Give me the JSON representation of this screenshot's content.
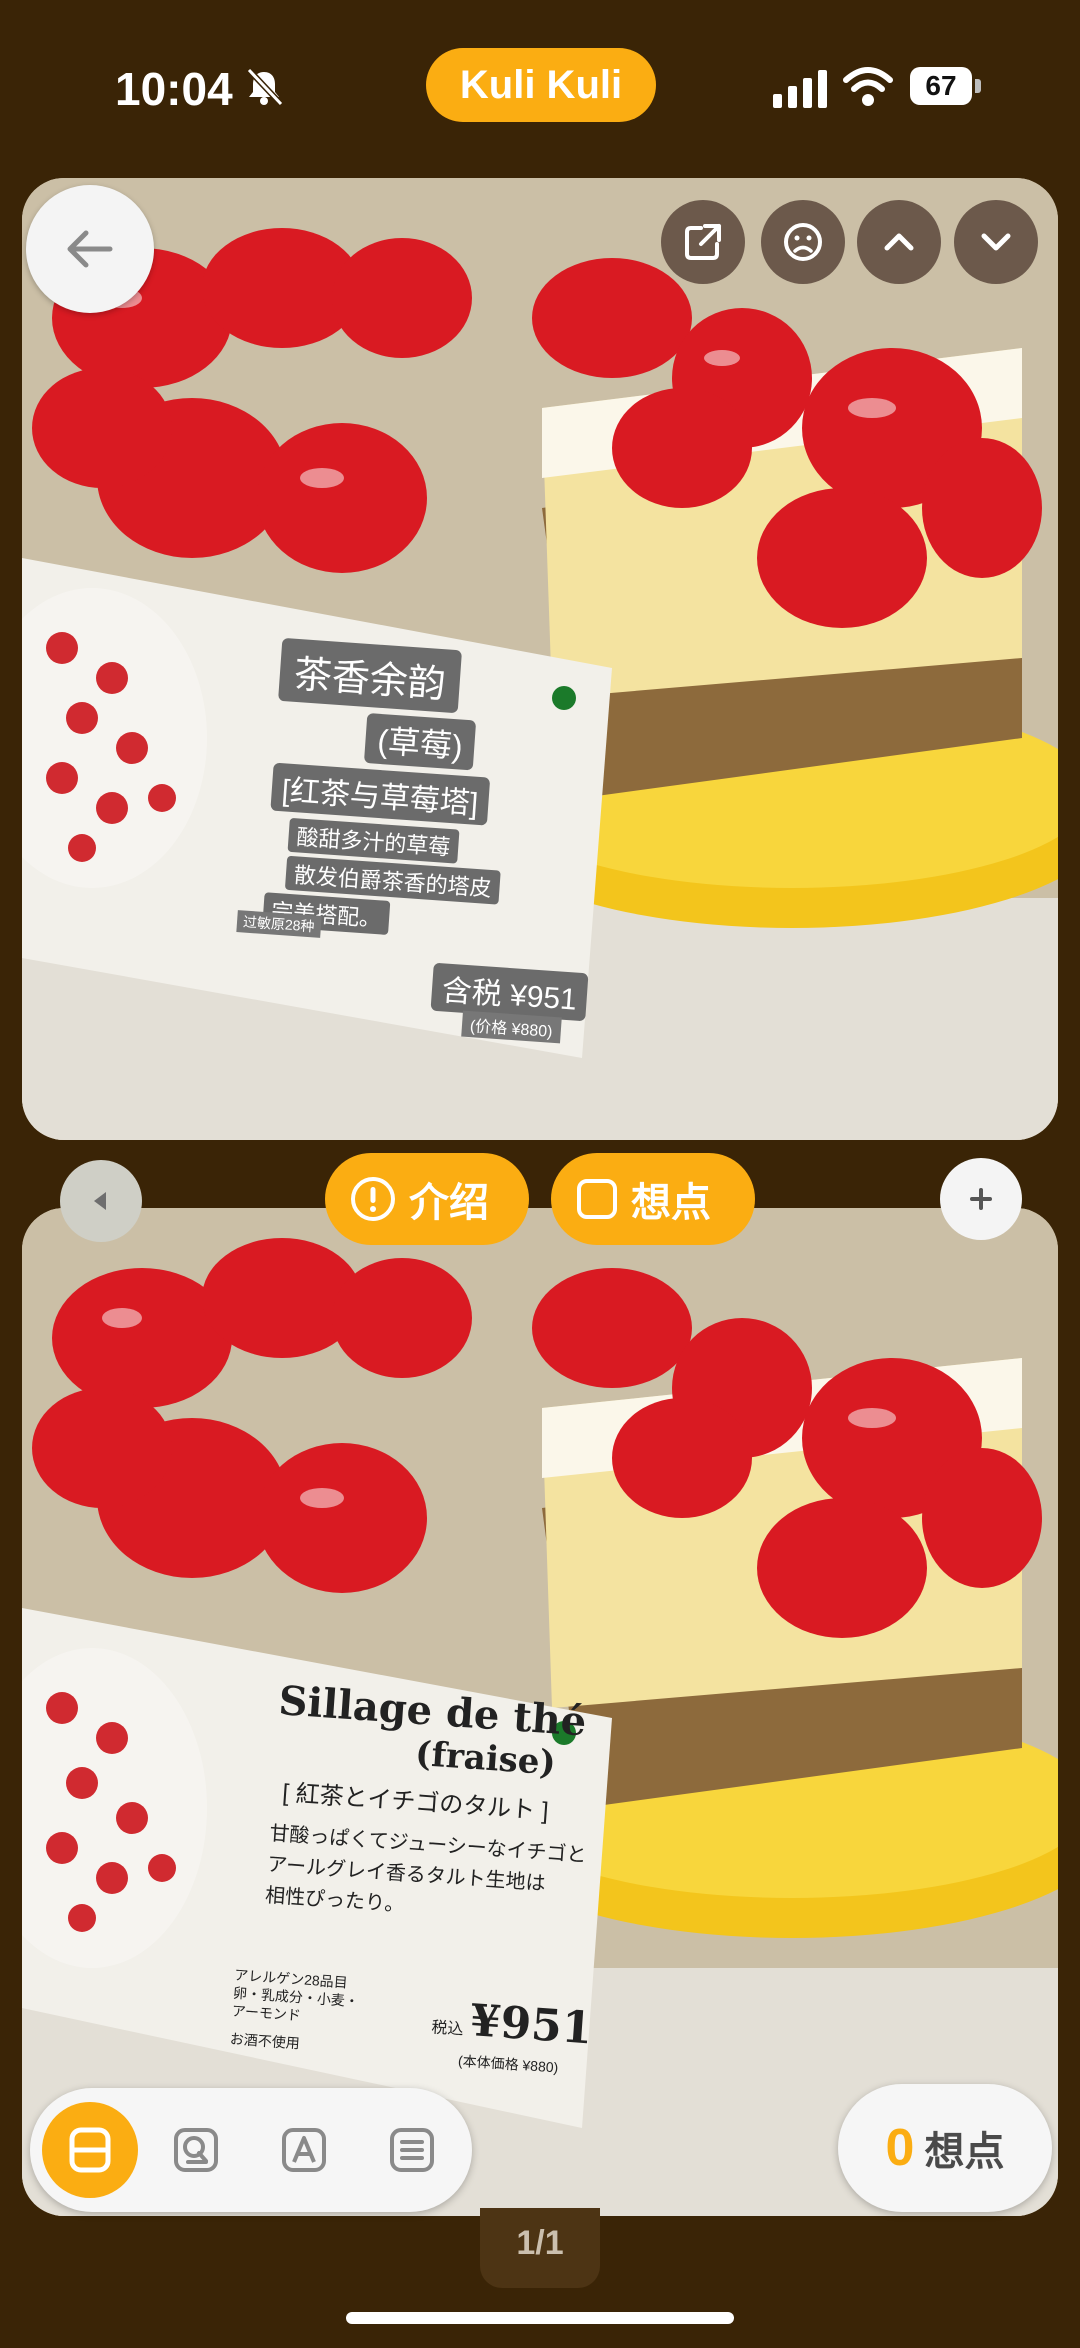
{
  "status_bar": {
    "time": "10:04",
    "app_name": "Kuli Kuli",
    "battery": "67"
  },
  "colors": {
    "accent": "#fbad12",
    "background": "#3a2406"
  },
  "top_image": {
    "label_title": "茶香余韵",
    "label_subtitle": "(草莓)",
    "label_name": "[红茶与草莓塔]",
    "label_desc_1": "酸甜多汁的草莓",
    "label_desc_2": "散发伯爵茶香的塔皮",
    "label_desc_3": "完美搭配。",
    "label_allergen": "过敏原28种",
    "label_price": "含税 ¥951",
    "label_base_price": "(价格 ¥880)"
  },
  "bottom_image": {
    "label_title": "Sillage de thé",
    "label_subtitle": "(fraise)",
    "label_name": "[ 紅茶とイチゴのタルト ]",
    "label_desc_1": "甘酸っぱくてジューシーなイチゴと",
    "label_desc_2": "アールグレイ香るタルト生地は",
    "label_desc_3": "相性ぴったり。",
    "label_allergen_1": "アレルゲン28品目",
    "label_allergen_2": "卵・乳成分・小麦・",
    "label_allergen_3": "アーモンド",
    "label_alcohol": "お酒不使用",
    "label_tax": "税込",
    "label_price": "¥951",
    "label_base_price": "(本体価格 ¥880)"
  },
  "buttons": {
    "intro_label": "介绍",
    "points_label": "想点"
  },
  "icons": {
    "back": "arrow-left-icon",
    "share": "share-icon",
    "sad": "sad-face-icon",
    "up": "chevron-up-icon",
    "down": "chevron-down-icon",
    "prev": "triangle-left-icon",
    "add": "plus-icon"
  },
  "toolbar": {
    "tools": [
      "split-view",
      "translate-q",
      "text-a",
      "list"
    ]
  },
  "counter": {
    "value": "0",
    "label": "想点"
  },
  "pagination": {
    "label": "1/1"
  }
}
